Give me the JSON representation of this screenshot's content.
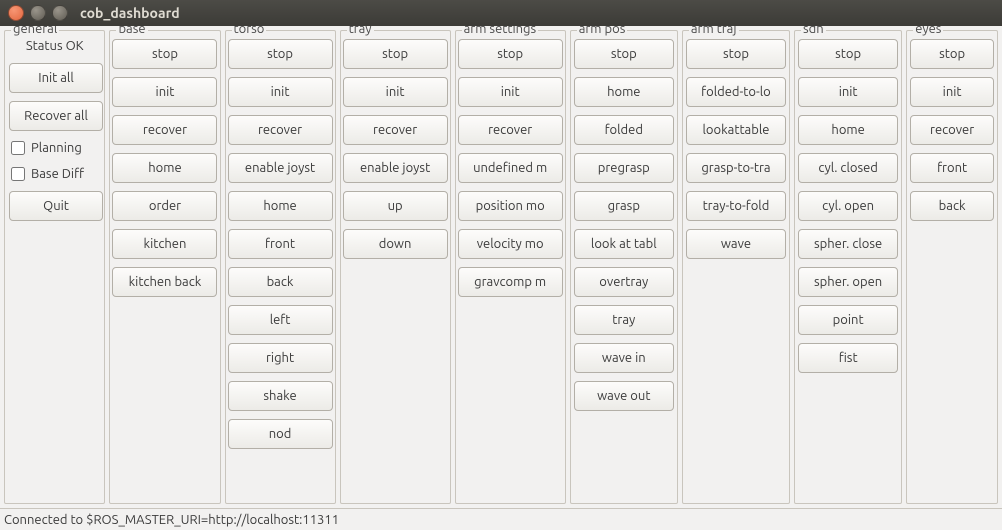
{
  "window": {
    "title": "cob_dashboard"
  },
  "statusbar": {
    "text": "Connected to $ROS_MASTER_URI=http://localhost:11311"
  },
  "general": {
    "title": "general",
    "status": "Status OK",
    "init_all": "Init all",
    "recover_all": "Recover all",
    "planning_label": "Planning",
    "basediff_label": "Base Diff",
    "quit": "Quit"
  },
  "base": {
    "title": "base",
    "buttons": [
      "stop",
      "init",
      "recover",
      "home",
      "order",
      "kitchen",
      "kitchen back"
    ]
  },
  "torso": {
    "title": "torso",
    "buttons": [
      "stop",
      "init",
      "recover",
      "enable joyst",
      "home",
      "front",
      "back",
      "left",
      "right",
      "shake",
      "nod"
    ]
  },
  "tray": {
    "title": "tray",
    "buttons": [
      "stop",
      "init",
      "recover",
      "enable joyst",
      "up",
      "down"
    ]
  },
  "arm_settings": {
    "title": "arm settings",
    "buttons": [
      "stop",
      "init",
      "recover",
      "undefined m",
      "position mo",
      "velocity mo",
      "gravcomp m"
    ]
  },
  "arm_pos": {
    "title": "arm pos",
    "buttons": [
      "stop",
      "home",
      "folded",
      "pregrasp",
      "grasp",
      "look at tabl",
      "overtray",
      "tray",
      "wave in",
      "wave out"
    ]
  },
  "arm_traj": {
    "title": "arm traj",
    "buttons": [
      "stop",
      "folded-to-lo",
      "lookattable",
      "grasp-to-tra",
      "tray-to-fold",
      "wave"
    ]
  },
  "sdh": {
    "title": "sdh",
    "buttons": [
      "stop",
      "init",
      "home",
      "cyl. closed",
      "cyl. open",
      "spher. close",
      "spher. open",
      "point",
      "fist"
    ]
  },
  "eyes": {
    "title": "eyes",
    "buttons": [
      "stop",
      "init",
      "recover",
      "front",
      "back"
    ]
  }
}
